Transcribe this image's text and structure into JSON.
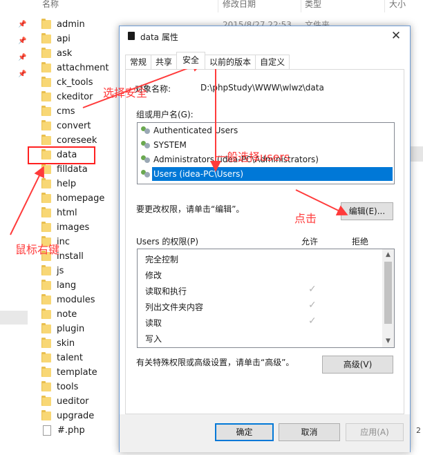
{
  "explorer": {
    "columns": {
      "name": "名称",
      "modified": "修改日期",
      "type": "类型",
      "size": "大小"
    },
    "first_row_date": "2015/8/27 22:53",
    "first_row_type": "文件夹",
    "files": [
      "admin",
      "api",
      "ask",
      "attachment",
      "ck_tools",
      "ckeditor",
      "cms",
      "convert",
      "coreseek",
      "data",
      "filldata",
      "help",
      "homepage",
      "html",
      "images",
      "inc",
      "install",
      "js",
      "lang",
      "modules",
      "note",
      "plugin",
      "skin",
      "talent",
      "template",
      "tools",
      "ueditor",
      "upgrade",
      "#.php"
    ],
    "right_edge_number": "2"
  },
  "dialog": {
    "title": "data 属性",
    "tabs": [
      "常规",
      "共享",
      "安全",
      "以前的版本",
      "自定义"
    ],
    "active_tab": "安全",
    "object_name_label": "对象名称:",
    "object_path": "D:\\phpStudy\\WWW\\wlwz\\data",
    "group_label": "组或用户名(G):",
    "groups": [
      "Authenticated Users",
      "SYSTEM",
      "Administrators (idea-PC\\Administrators)",
      "Users (idea-PC\\Users)"
    ],
    "selected_group": "Users (idea-PC\\Users)",
    "change_perm_note": "要更改权限，请单击“编辑”。",
    "edit_button": "编辑(E)...",
    "perms_label": "Users 的权限(P)",
    "allow_label": "允许",
    "deny_label": "拒绝",
    "permissions": [
      {
        "name": "完全控制",
        "allow": false
      },
      {
        "name": "修改",
        "allow": false
      },
      {
        "name": "读取和执行",
        "allow": true
      },
      {
        "name": "列出文件夹内容",
        "allow": true
      },
      {
        "name": "读取",
        "allow": true
      },
      {
        "name": "写入",
        "allow": false
      }
    ],
    "check_glyph": "✓",
    "advanced_note": "有关特殊权限或高级设置，请单击“高级”。",
    "advanced_button": "高级(V)",
    "ok_button": "确定",
    "cancel_button": "取消",
    "apply_button": "应用(A)"
  },
  "annotations": {
    "right_click": "鼠标右键",
    "select_security": "选择安全",
    "select_users": "一般选择users",
    "click": "点击",
    "color": "#ff3b3b"
  }
}
